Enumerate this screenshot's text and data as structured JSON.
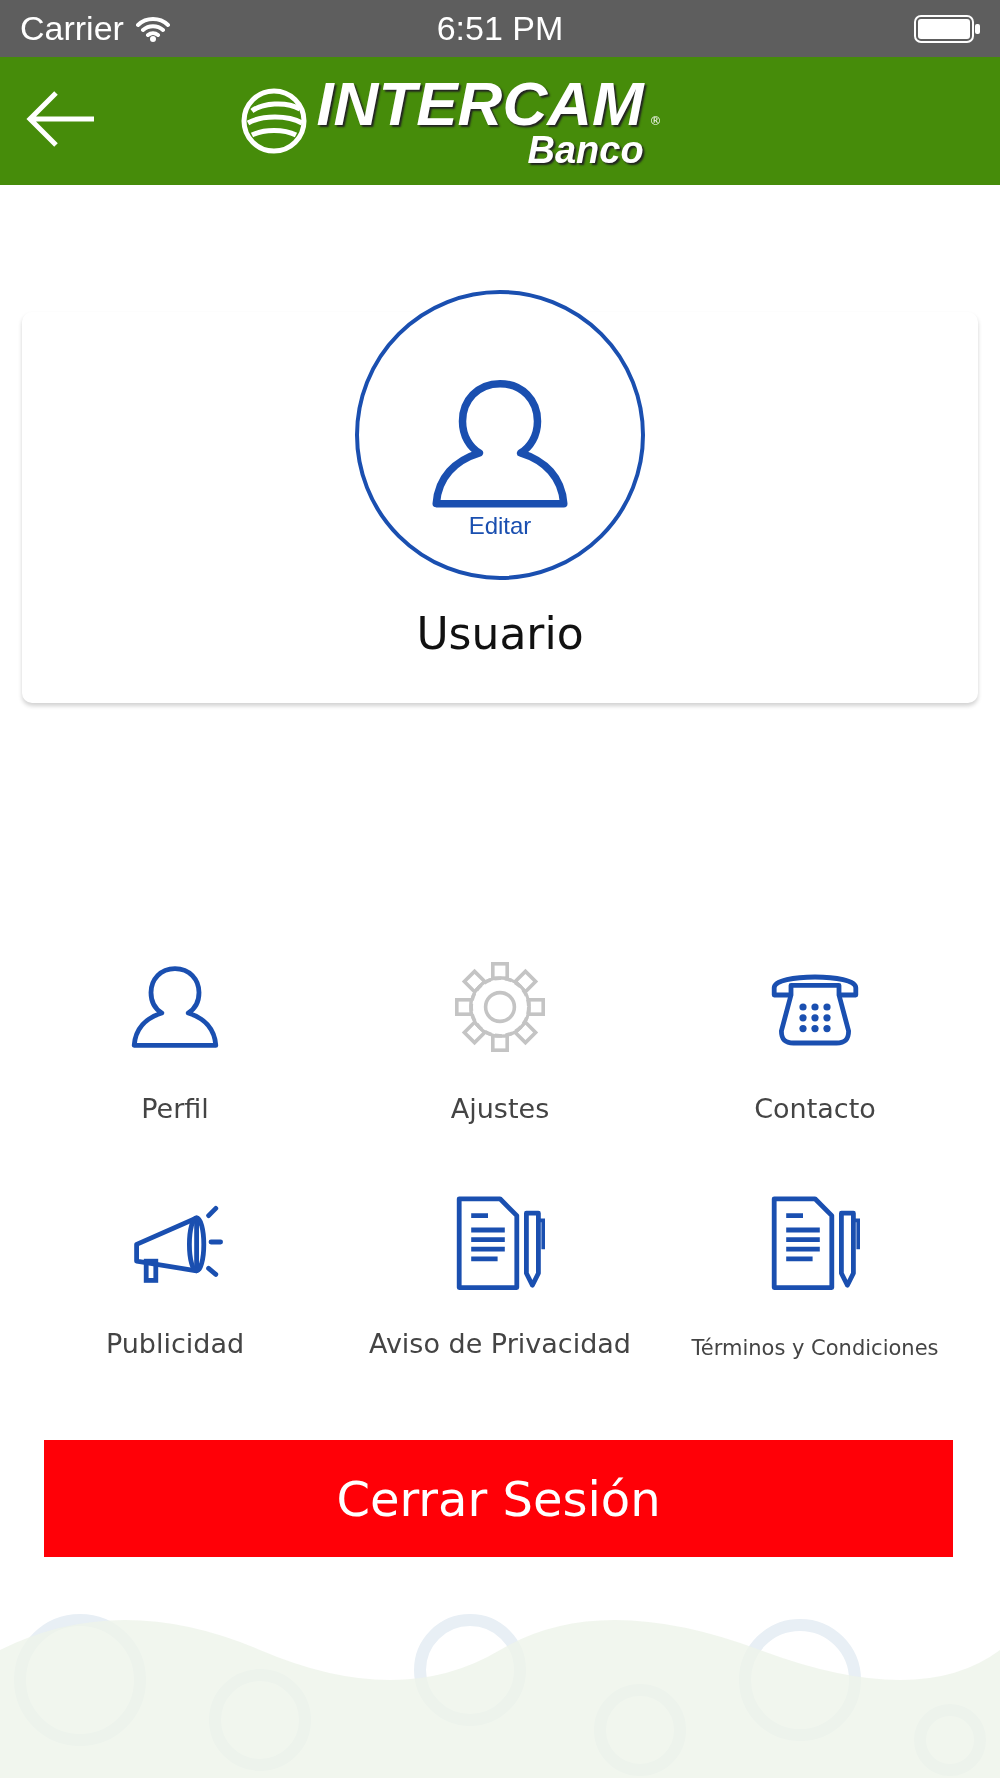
{
  "status_bar": {
    "carrier": "Carrier",
    "time": "6:51 PM"
  },
  "header": {
    "logo": {
      "name": "INTERCAM",
      "registered": "®",
      "subtitle": "Banco"
    }
  },
  "profile": {
    "edit_label": "Editar",
    "user_name": "Usuario"
  },
  "menu": [
    {
      "label": "Perfil",
      "kind": "person",
      "disabled": false
    },
    {
      "label": "Ajustes",
      "kind": "gear",
      "disabled": true
    },
    {
      "label": "Contacto",
      "kind": "phone",
      "disabled": false
    },
    {
      "label": "Publicidad",
      "kind": "megaphone",
      "disabled": false
    },
    {
      "label": "Aviso de Privacidad",
      "kind": "document",
      "disabled": false
    },
    {
      "label": "Términos y Condiciones",
      "kind": "document",
      "disabled": false,
      "small": true
    }
  ],
  "logout_button": "Cerrar Sesión"
}
